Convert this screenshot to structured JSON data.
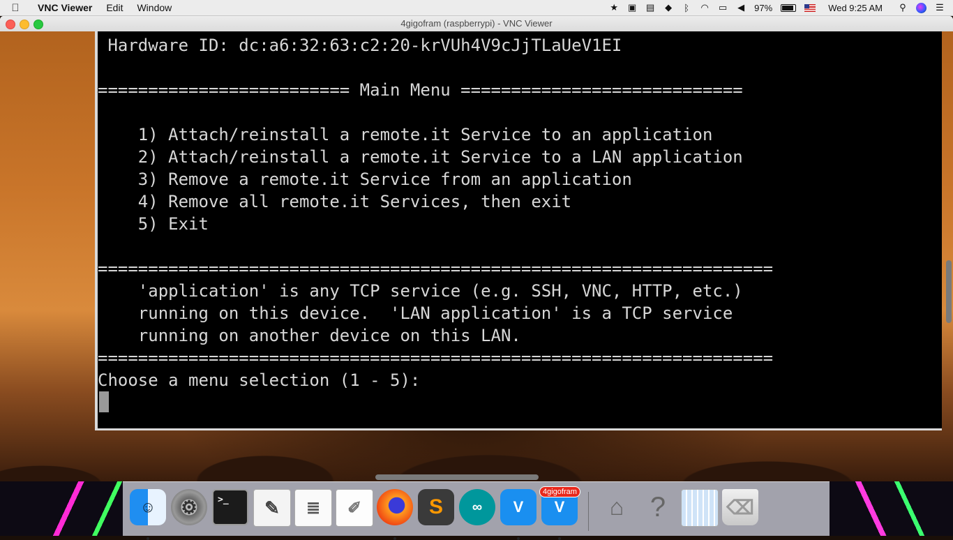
{
  "menubar": {
    "app_name": "VNC Viewer",
    "menus": [
      "Edit",
      "Window"
    ],
    "status_icons": [
      "star-icon",
      "package-icon",
      "display-mirror-icon",
      "dropbox-icon",
      "bluetooth-icon",
      "wifi-icon",
      "airplay-icon",
      "volume-icon"
    ],
    "battery_percent": "97%",
    "clock": "Wed 9:25 AM"
  },
  "window": {
    "title": "4gigofram (raspberrypi) - VNC Viewer"
  },
  "terminal": {
    "hardware_id": " Hardware ID: dc:a6:32:63:c2:20-krVUh4V9cJjTLaUeV1EI",
    "menu_header": "========================= Main Menu ============================",
    "options": [
      "    1) Attach/reinstall a remote.it Service to an application",
      "    2) Attach/reinstall a remote.it Service to a LAN application",
      "    3) Remove a remote.it Service from an application",
      "    4) Remove all remote.it Services, then exit",
      "    5) Exit"
    ],
    "separator": "===================================================================",
    "info_lines": [
      "    'application' is any TCP service (e.g. SSH, VNC, HTTP, etc.)",
      "    running on this device.  'LAN application' is a TCP service",
      "    running on another device on this LAN."
    ],
    "prompt": "Choose a menu selection (1 - 5):"
  },
  "dock": {
    "apps": [
      {
        "name": "finder-icon",
        "running": true
      },
      {
        "name": "system-preferences-icon",
        "running": false
      },
      {
        "name": "terminal-icon",
        "running": false
      },
      {
        "name": "script-editor-icon",
        "running": false
      },
      {
        "name": "textedit-icon",
        "running": false
      },
      {
        "name": "notes-document-icon",
        "running": false
      },
      {
        "name": "firefox-icon",
        "running": true
      },
      {
        "name": "sublime-text-icon",
        "running": false
      },
      {
        "name": "arduino-icon",
        "running": false
      },
      {
        "name": "vnc-viewer-icon",
        "running": true
      },
      {
        "name": "vnc-viewer-badge-icon",
        "running": true,
        "badge": "4gigofram"
      }
    ],
    "other_items": [
      "preview-icon",
      "help-icon",
      "screenshot-icon",
      "trash-icon"
    ],
    "terminal_glyph": ">_",
    "help_glyph": "?"
  }
}
